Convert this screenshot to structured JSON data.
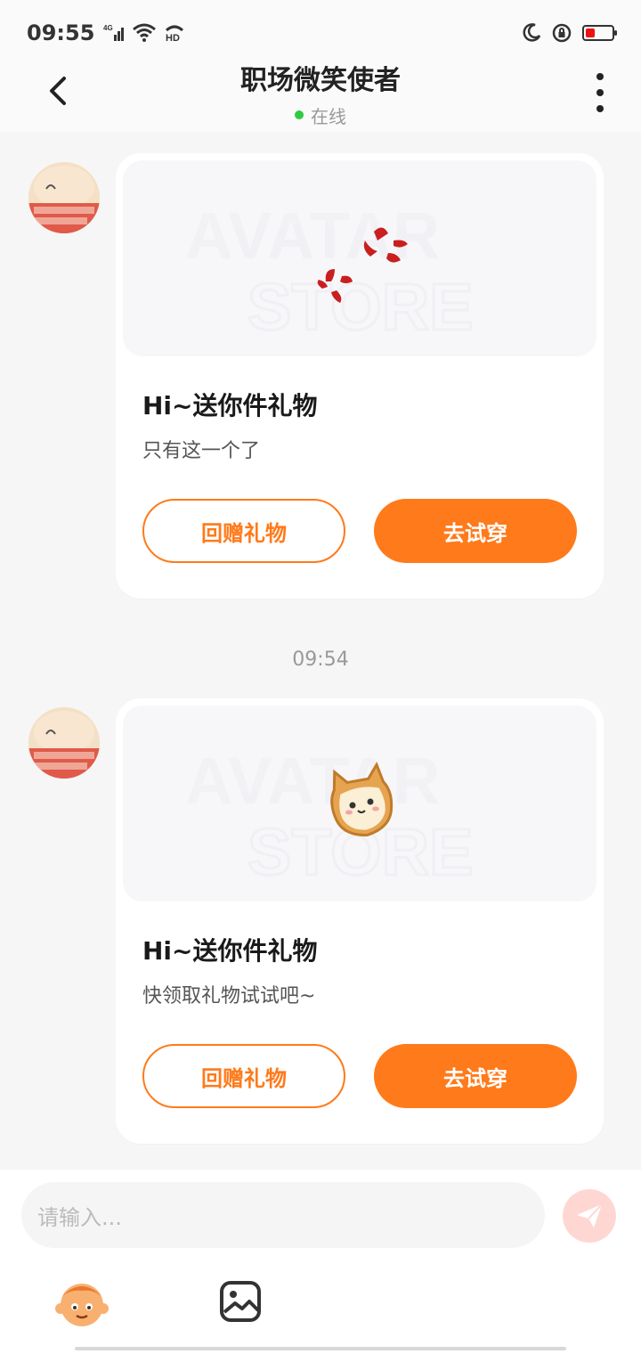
{
  "status": {
    "time": "09:55",
    "network_badge": "4G",
    "hd_badge": "HD"
  },
  "header": {
    "title": "职场微笑使者",
    "online_status": "在线"
  },
  "messages": [
    {
      "heading": "Hi~送你件礼物",
      "subtitle": "只有这一个了",
      "return_gift_label": "回赠礼物",
      "try_on_label": "去试穿"
    },
    {
      "heading": "Hi~送你件礼物",
      "subtitle": "快领取礼物试试吧~",
      "return_gift_label": "回赠礼物",
      "try_on_label": "去试穿"
    }
  ],
  "time_separator": "09:54",
  "input": {
    "placeholder": "请输入..."
  },
  "watermark": {
    "line1": "AVATAR",
    "line2": "STORE"
  },
  "colors": {
    "accent": "#ff7a1a",
    "online": "#2ecc40"
  }
}
